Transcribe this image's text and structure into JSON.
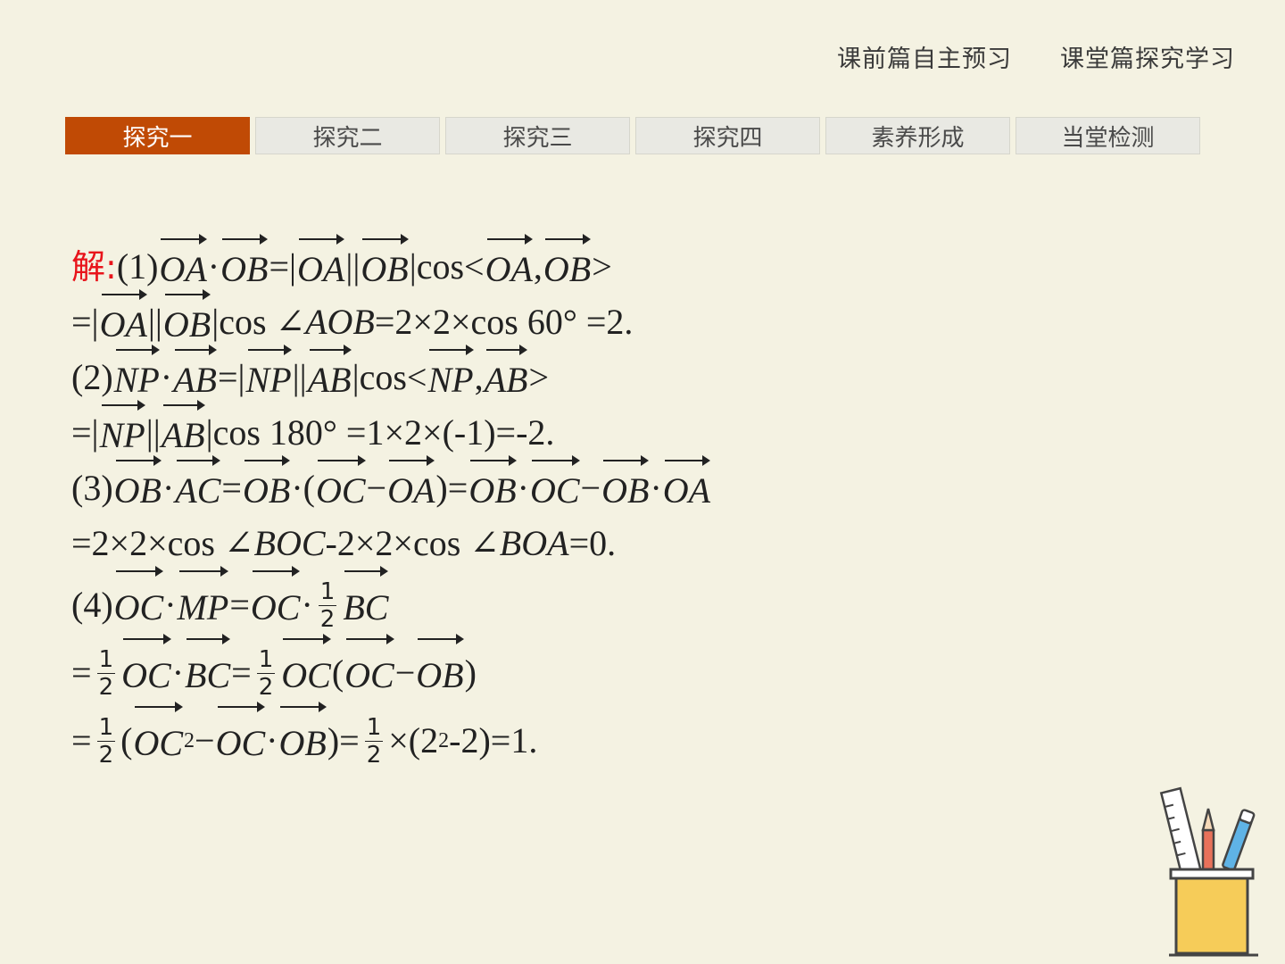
{
  "nav": {
    "preview": "课前篇自主预习",
    "classroom": "课堂篇探究学习"
  },
  "tabs": [
    {
      "label": "探究一"
    },
    {
      "label": "探究二"
    },
    {
      "label": "探究三"
    },
    {
      "label": "探究四"
    },
    {
      "label": "素养形成"
    },
    {
      "label": "当堂检测"
    }
  ],
  "solution": {
    "label": "解:",
    "line1": {
      "pre": "(1)",
      "v1": "OA",
      "dot": "·",
      "v2": "OB",
      "eq": "=|",
      "v3": "OA",
      "bar": "||",
      "v4": "OB",
      "cos": "|cos<",
      "v5": "OA",
      "comma": ",",
      "v6": "OB",
      "end": ">"
    },
    "line2": {
      "pre": "=|",
      "v1": "OA",
      "bar": "||",
      "v2": "OB",
      "cos": "|cos ∠",
      "angle": "AOB",
      "rest": "=2×2×cos 60° =2."
    },
    "line3": {
      "pre": "(2)",
      "v1": "NP",
      "dot": "·",
      "v2": "AB",
      "eq": "=|",
      "v3": "NP",
      "bar": "||",
      "v4": "AB",
      "cos": "|cos<",
      "v5": "NP",
      "comma": ",",
      "v6": "AB",
      "end": ">"
    },
    "line4": {
      "pre": "=|",
      "v1": "NP",
      "bar": "||",
      "v2": "AB",
      "rest": "|cos 180° =1×2×(-1)=-2."
    },
    "line5": {
      "pre": "(3)",
      "v1": "OB",
      "dot": "·",
      "v2": "AC",
      "eq": "=",
      "v3": "OB",
      "open": "·(",
      "v4": "OC",
      "minus": "−",
      "v5": "OA",
      "close": ")=",
      "v6": "OB",
      "dot2": "·",
      "v7": "OC",
      "minus2": "−",
      "v8": "OB",
      "dot3": "·",
      "v9": "OA"
    },
    "line6": {
      "pre": "=2×2×cos ∠",
      "angle1": "BOC",
      "mid": "-2×2×cos ∠",
      "angle2": "BOA",
      "end": "=0."
    },
    "line7": {
      "pre": "(4)",
      "v1": "OC",
      "dot": "·",
      "v2": "MP",
      "eq": "=",
      "v3": "OC",
      "dot2": "·",
      "num": "1",
      "den": "2",
      "v4": "BC"
    },
    "line8": {
      "pre": "=",
      "num": "1",
      "den": "2",
      "v1": "OC",
      "dot": "·",
      "v2": "BC",
      "eq": "=",
      "num2": "1",
      "den2": "2",
      "v3": "OC",
      "open": "(",
      "v4": "OC",
      "minus": "−",
      "v5": "OB",
      "close": ")"
    },
    "line9": {
      "pre": "=",
      "num": "1",
      "den": "2",
      "open": "(",
      "v1": "OC",
      "sq": "2",
      "minus": "−",
      "v2": "OC",
      "dot": "·",
      "v3": "OB",
      "close": ")=",
      "num2": "1",
      "den2": "2",
      "rest": "×(2",
      "sup": "2",
      "end": "-2)=1."
    }
  },
  "icons": {
    "decor": "pen-holder-icon"
  },
  "colors": {
    "background": "#f4f2e2",
    "active_tab": "#c04a05",
    "label": "#e8141b"
  }
}
